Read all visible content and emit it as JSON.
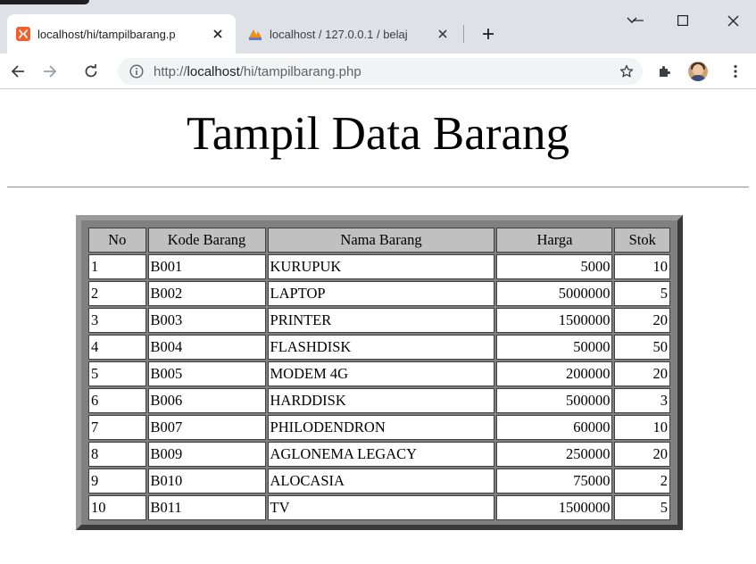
{
  "browser": {
    "tabs": [
      {
        "title": "localhost/hi/tampilbarang.p",
        "favicon": "xampp-icon",
        "active": true
      },
      {
        "title": "localhost / 127.0.0.1 / belaj",
        "favicon": "phpmyadmin-icon",
        "active": false
      }
    ],
    "url": {
      "scheme": "http://",
      "host": "localhost",
      "path": "/hi/tampilbarang.php"
    }
  },
  "page": {
    "title": "Tampil Data Barang",
    "table": {
      "headers": [
        "No",
        "Kode Barang",
        "Nama Barang",
        "Harga",
        "Stok"
      ],
      "rows": [
        [
          "1",
          "B001",
          "KURUPUK",
          "5000",
          "10"
        ],
        [
          "2",
          "B002",
          "LAPTOP",
          "5000000",
          "5"
        ],
        [
          "3",
          "B003",
          "PRINTER",
          "1500000",
          "20"
        ],
        [
          "4",
          "B004",
          "FLASHDISK",
          "50000",
          "50"
        ],
        [
          "5",
          "B005",
          "MODEM 4G",
          "200000",
          "20"
        ],
        [
          "6",
          "B006",
          "HARDDISK",
          "500000",
          "3"
        ],
        [
          "7",
          "B007",
          "PHILODENDRON",
          "60000",
          "10"
        ],
        [
          "8",
          "B009",
          "AGLONEMA LEGACY",
          "250000",
          "20"
        ],
        [
          "9",
          "B010",
          "ALOCASIA",
          "75000",
          "2"
        ],
        [
          "10",
          "B011",
          "TV",
          "1500000",
          "5"
        ]
      ]
    }
  },
  "colors": {
    "xampp_orange": "#f2602d",
    "table_header_bg": "#c0c0c0",
    "table_frame": "#808080"
  }
}
